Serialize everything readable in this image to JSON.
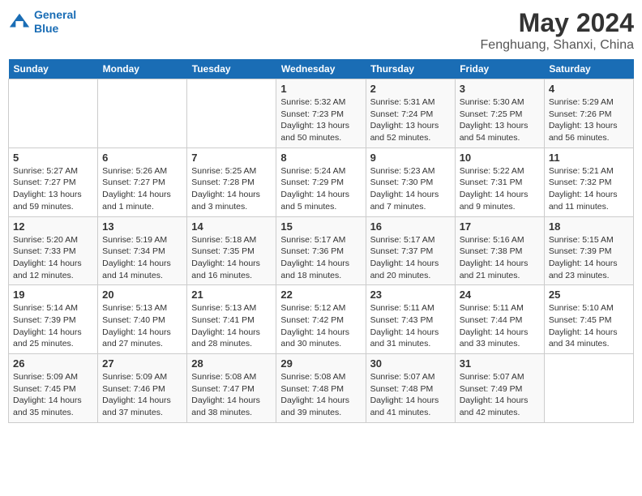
{
  "header": {
    "logo_line1": "General",
    "logo_line2": "Blue",
    "title": "May 2024",
    "subtitle": "Fenghuang, Shanxi, China"
  },
  "days_of_week": [
    "Sunday",
    "Monday",
    "Tuesday",
    "Wednesday",
    "Thursday",
    "Friday",
    "Saturday"
  ],
  "weeks": [
    [
      {
        "day": "",
        "info": ""
      },
      {
        "day": "",
        "info": ""
      },
      {
        "day": "",
        "info": ""
      },
      {
        "day": "1",
        "info": "Sunrise: 5:32 AM\nSunset: 7:23 PM\nDaylight: 13 hours\nand 50 minutes."
      },
      {
        "day": "2",
        "info": "Sunrise: 5:31 AM\nSunset: 7:24 PM\nDaylight: 13 hours\nand 52 minutes."
      },
      {
        "day": "3",
        "info": "Sunrise: 5:30 AM\nSunset: 7:25 PM\nDaylight: 13 hours\nand 54 minutes."
      },
      {
        "day": "4",
        "info": "Sunrise: 5:29 AM\nSunset: 7:26 PM\nDaylight: 13 hours\nand 56 minutes."
      }
    ],
    [
      {
        "day": "5",
        "info": "Sunrise: 5:27 AM\nSunset: 7:27 PM\nDaylight: 13 hours\nand 59 minutes."
      },
      {
        "day": "6",
        "info": "Sunrise: 5:26 AM\nSunset: 7:27 PM\nDaylight: 14 hours\nand 1 minute."
      },
      {
        "day": "7",
        "info": "Sunrise: 5:25 AM\nSunset: 7:28 PM\nDaylight: 14 hours\nand 3 minutes."
      },
      {
        "day": "8",
        "info": "Sunrise: 5:24 AM\nSunset: 7:29 PM\nDaylight: 14 hours\nand 5 minutes."
      },
      {
        "day": "9",
        "info": "Sunrise: 5:23 AM\nSunset: 7:30 PM\nDaylight: 14 hours\nand 7 minutes."
      },
      {
        "day": "10",
        "info": "Sunrise: 5:22 AM\nSunset: 7:31 PM\nDaylight: 14 hours\nand 9 minutes."
      },
      {
        "day": "11",
        "info": "Sunrise: 5:21 AM\nSunset: 7:32 PM\nDaylight: 14 hours\nand 11 minutes."
      }
    ],
    [
      {
        "day": "12",
        "info": "Sunrise: 5:20 AM\nSunset: 7:33 PM\nDaylight: 14 hours\nand 12 minutes."
      },
      {
        "day": "13",
        "info": "Sunrise: 5:19 AM\nSunset: 7:34 PM\nDaylight: 14 hours\nand 14 minutes."
      },
      {
        "day": "14",
        "info": "Sunrise: 5:18 AM\nSunset: 7:35 PM\nDaylight: 14 hours\nand 16 minutes."
      },
      {
        "day": "15",
        "info": "Sunrise: 5:17 AM\nSunset: 7:36 PM\nDaylight: 14 hours\nand 18 minutes."
      },
      {
        "day": "16",
        "info": "Sunrise: 5:17 AM\nSunset: 7:37 PM\nDaylight: 14 hours\nand 20 minutes."
      },
      {
        "day": "17",
        "info": "Sunrise: 5:16 AM\nSunset: 7:38 PM\nDaylight: 14 hours\nand 21 minutes."
      },
      {
        "day": "18",
        "info": "Sunrise: 5:15 AM\nSunset: 7:39 PM\nDaylight: 14 hours\nand 23 minutes."
      }
    ],
    [
      {
        "day": "19",
        "info": "Sunrise: 5:14 AM\nSunset: 7:39 PM\nDaylight: 14 hours\nand 25 minutes."
      },
      {
        "day": "20",
        "info": "Sunrise: 5:13 AM\nSunset: 7:40 PM\nDaylight: 14 hours\nand 27 minutes."
      },
      {
        "day": "21",
        "info": "Sunrise: 5:13 AM\nSunset: 7:41 PM\nDaylight: 14 hours\nand 28 minutes."
      },
      {
        "day": "22",
        "info": "Sunrise: 5:12 AM\nSunset: 7:42 PM\nDaylight: 14 hours\nand 30 minutes."
      },
      {
        "day": "23",
        "info": "Sunrise: 5:11 AM\nSunset: 7:43 PM\nDaylight: 14 hours\nand 31 minutes."
      },
      {
        "day": "24",
        "info": "Sunrise: 5:11 AM\nSunset: 7:44 PM\nDaylight: 14 hours\nand 33 minutes."
      },
      {
        "day": "25",
        "info": "Sunrise: 5:10 AM\nSunset: 7:45 PM\nDaylight: 14 hours\nand 34 minutes."
      }
    ],
    [
      {
        "day": "26",
        "info": "Sunrise: 5:09 AM\nSunset: 7:45 PM\nDaylight: 14 hours\nand 35 minutes."
      },
      {
        "day": "27",
        "info": "Sunrise: 5:09 AM\nSunset: 7:46 PM\nDaylight: 14 hours\nand 37 minutes."
      },
      {
        "day": "28",
        "info": "Sunrise: 5:08 AM\nSunset: 7:47 PM\nDaylight: 14 hours\nand 38 minutes."
      },
      {
        "day": "29",
        "info": "Sunrise: 5:08 AM\nSunset: 7:48 PM\nDaylight: 14 hours\nand 39 minutes."
      },
      {
        "day": "30",
        "info": "Sunrise: 5:07 AM\nSunset: 7:48 PM\nDaylight: 14 hours\nand 41 minutes."
      },
      {
        "day": "31",
        "info": "Sunrise: 5:07 AM\nSunset: 7:49 PM\nDaylight: 14 hours\nand 42 minutes."
      },
      {
        "day": "",
        "info": ""
      }
    ]
  ]
}
